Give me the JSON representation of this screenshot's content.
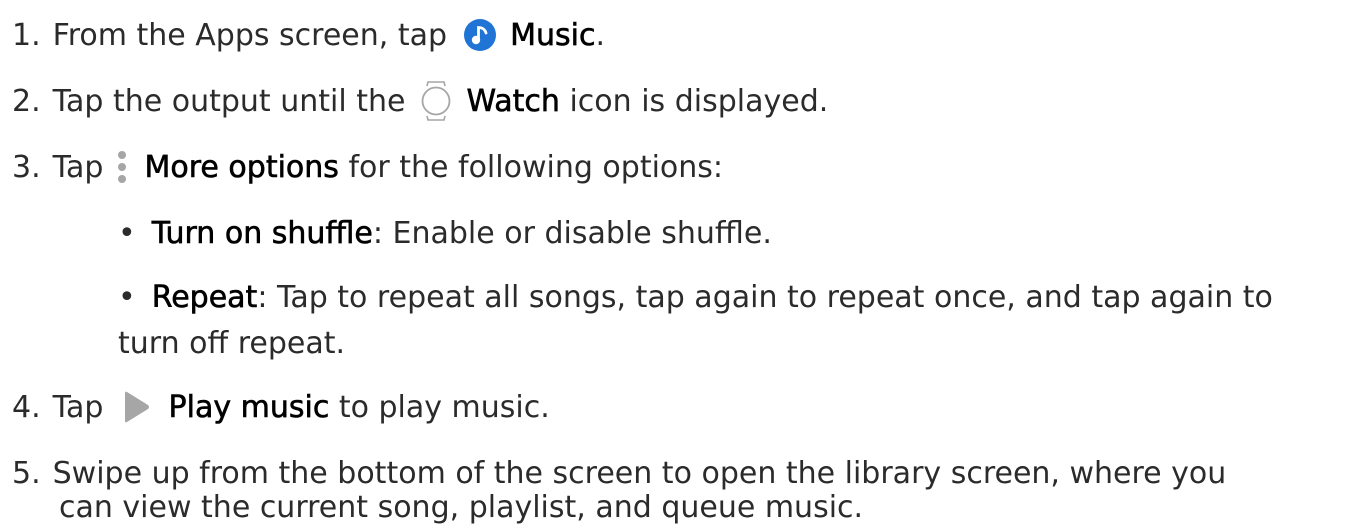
{
  "steps": [
    {
      "number": "1.",
      "before": "From the Apps screen, tap",
      "icon": "music-app-icon",
      "bold": "Music",
      "after": "."
    },
    {
      "number": "2.",
      "before": "Tap the output until the",
      "icon": "watch-icon",
      "bold": "Watch",
      "after": " icon is displayed."
    },
    {
      "number": "3.",
      "before": "Tap",
      "icon": "more-options-icon",
      "bold": "More options",
      "after": " for the following options:",
      "sub_items": [
        {
          "bold": "Turn on shuffle",
          "text": ": Enable or disable shuffle."
        },
        {
          "bold": "Repeat",
          "text": ": Tap to repeat all songs, tap again to repeat once, and tap again to",
          "continuation": "turn off repeat."
        }
      ]
    },
    {
      "number": "4.",
      "before": "Tap",
      "icon": "play-icon",
      "bold": "Play music",
      "after": " to play music."
    },
    {
      "number": "5.",
      "text": "Swipe up from the bottom of the screen to open the library screen, where you",
      "continuation": "can view the current song, playlist, and queue music."
    }
  ],
  "colors": {
    "text": "#2b2b2b",
    "music_icon": "#1f74d6",
    "icon_gray": "#a6a6a6"
  }
}
